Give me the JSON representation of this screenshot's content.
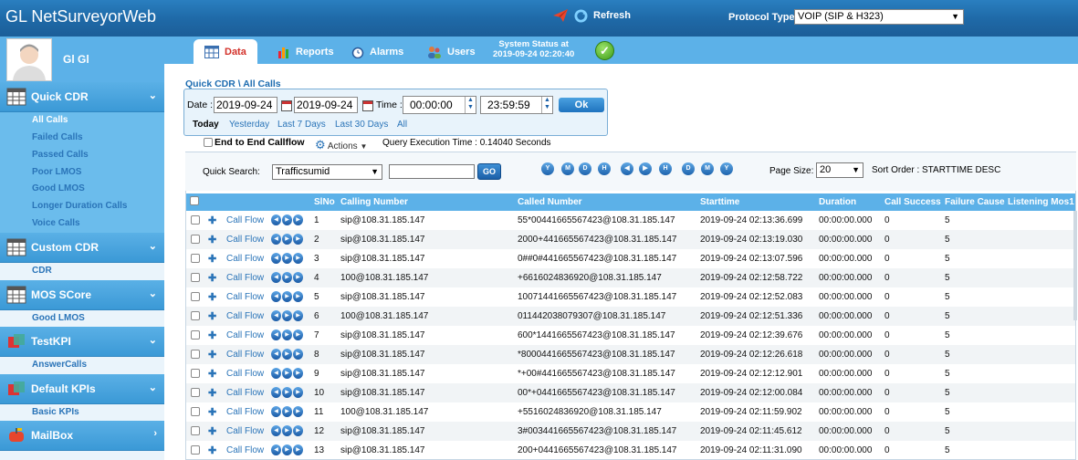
{
  "header": {
    "app_title": "GL NetSurveyorWeb",
    "refresh_label": "Refresh",
    "protocol_label": "Protocol Type",
    "protocol_value": "VOIP (SIP & H323)"
  },
  "nav": {
    "tabs": [
      {
        "label": "Data",
        "icon": "data-icon",
        "active": true
      },
      {
        "label": "Reports",
        "icon": "reports-icon"
      },
      {
        "label": "Alarms",
        "icon": "alarms-icon"
      },
      {
        "label": "Users",
        "icon": "users-icon"
      }
    ],
    "status_line1": "System Status at",
    "status_line2": "2019-09-24 02:20:40"
  },
  "sidebar": {
    "username": "Gl Gl",
    "sections": [
      {
        "label": "Quick CDR",
        "items": [
          "All Calls",
          "Failed Calls",
          "Passed Calls",
          "Poor LMOS",
          "Good LMOS",
          "Longer Duration Calls",
          "Voice Calls"
        ],
        "selected": "All Calls"
      },
      {
        "label": "Custom CDR",
        "items": [
          "CDR"
        ]
      },
      {
        "label": "MOS SCore",
        "items": [
          "Good LMOS"
        ]
      },
      {
        "label": "TestKPI",
        "items": [
          "AnswerCalls"
        ]
      },
      {
        "label": "Default KPIs",
        "items": [
          "Basic KPIs"
        ]
      },
      {
        "label": "MailBox",
        "items": []
      }
    ]
  },
  "main": {
    "breadcrumb": "Quick CDR \\ All Calls",
    "date_label": "Date :",
    "date_from": "2019-09-24",
    "date_to": "2019-09-24",
    "time_label": "Time :",
    "time_from": "00:00:00",
    "time_to": "23:59:59",
    "ok_label": "Ok",
    "ranges": [
      "Today",
      "Yesterday",
      "Last 7 Days",
      "Last 30 Days",
      "All"
    ],
    "e2e_label": "End to End Callflow",
    "actions_label": "Actions",
    "query_time": "Query Execution Time : 0.14040 Seconds",
    "quick_search_label": "Quick Search:",
    "quick_search_field": "Trafficsumid",
    "go_label": "GO",
    "page_size_label": "Page Size:",
    "page_size": "20",
    "sort_order": "Sort Order : STARTTIME DESC",
    "pager": [
      "first",
      "prev-year",
      "prev-month",
      "prev-day",
      "prev",
      "next",
      "next-day",
      "next-month",
      "next-year",
      "last"
    ]
  },
  "table": {
    "columns": [
      "SlNo",
      "Calling Number",
      "Called Number",
      "Starttime",
      "Duration",
      "Call Success",
      "Failure Cause",
      "Listening Mos1"
    ],
    "link_label": "Call Flow",
    "rows": [
      [
        "1",
        "sip@108.31.185.147",
        "55*00441665567423@108.31.185.147",
        "2019-09-24 02:13:36.699",
        "00:00:00.000",
        "0",
        "5"
      ],
      [
        "2",
        "sip@108.31.185.147",
        "2000+441665567423@108.31.185.147",
        "2019-09-24 02:13:19.030",
        "00:00:00.000",
        "0",
        "5"
      ],
      [
        "3",
        "sip@108.31.185.147",
        "0##0#441665567423@108.31.185.147",
        "2019-09-24 02:13:07.596",
        "00:00:00.000",
        "0",
        "5"
      ],
      [
        "4",
        "100@108.31.185.147",
        "+6616024836920@108.31.185.147",
        "2019-09-24 02:12:58.722",
        "00:00:00.000",
        "0",
        "5"
      ],
      [
        "5",
        "sip@108.31.185.147",
        "10071441665567423@108.31.185.147",
        "2019-09-24 02:12:52.083",
        "00:00:00.000",
        "0",
        "5"
      ],
      [
        "6",
        "100@108.31.185.147",
        "011442038079307@108.31.185.147",
        "2019-09-24 02:12:51.336",
        "00:00:00.000",
        "0",
        "5"
      ],
      [
        "7",
        "sip@108.31.185.147",
        "600*1441665567423@108.31.185.147",
        "2019-09-24 02:12:39.676",
        "00:00:00.000",
        "0",
        "5"
      ],
      [
        "8",
        "sip@108.31.185.147",
        "*8000441665567423@108.31.185.147",
        "2019-09-24 02:12:26.618",
        "00:00:00.000",
        "0",
        "5"
      ],
      [
        "9",
        "sip@108.31.185.147",
        "*+00#441665567423@108.31.185.147",
        "2019-09-24 02:12:12.901",
        "00:00:00.000",
        "0",
        "5"
      ],
      [
        "10",
        "sip@108.31.185.147",
        "00*+0441665567423@108.31.185.147",
        "2019-09-24 02:12:00.084",
        "00:00:00.000",
        "0",
        "5"
      ],
      [
        "11",
        "100@108.31.185.147",
        "+5516024836920@108.31.185.147",
        "2019-09-24 02:11:59.902",
        "00:00:00.000",
        "0",
        "5"
      ],
      [
        "12",
        "sip@108.31.185.147",
        "3#003441665567423@108.31.185.147",
        "2019-09-24 02:11:45.612",
        "00:00:00.000",
        "0",
        "5"
      ],
      [
        "13",
        "sip@108.31.185.147",
        "200+0441665567423@108.31.185.147",
        "2019-09-24 02:11:31.090",
        "00:00:00.000",
        "0",
        "5"
      ]
    ]
  },
  "colors": {
    "header_blue": "#1f6aa8",
    "nav_blue": "#5cb1e8",
    "link_blue": "#2a74b8",
    "active_tab_red": "#d3312a",
    "status_ok_green": "#3c9b16"
  }
}
